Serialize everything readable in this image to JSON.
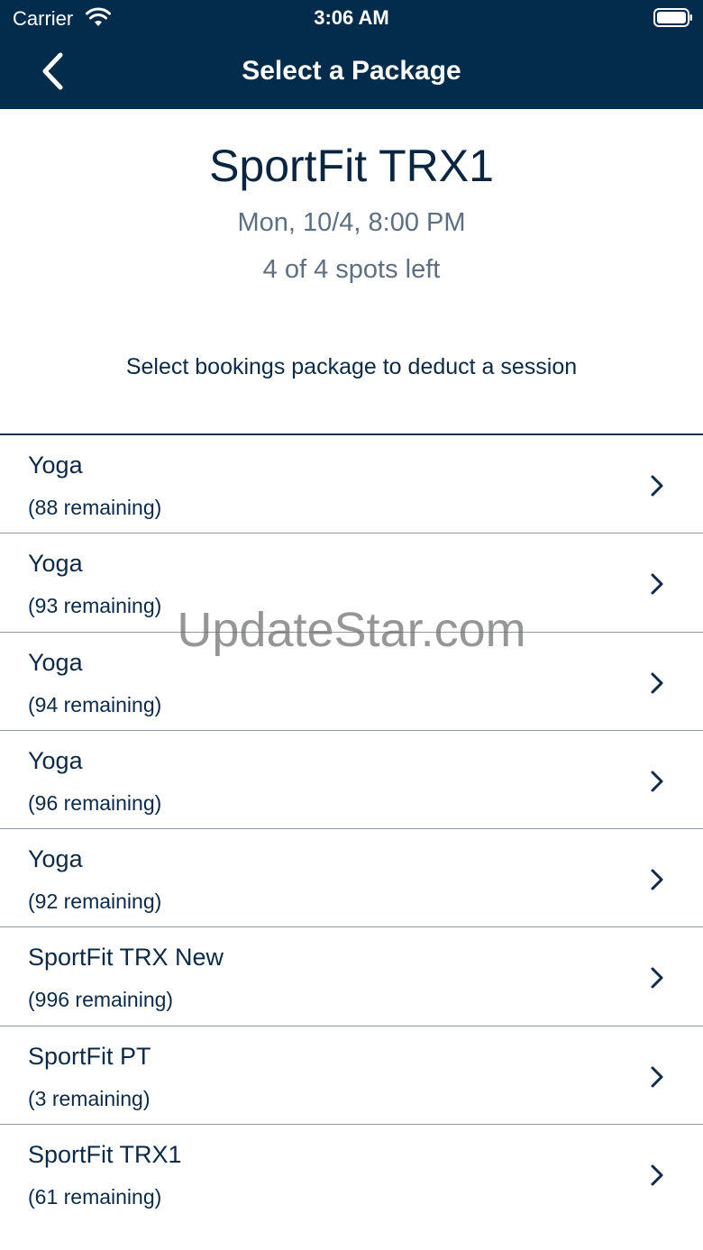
{
  "status_bar": {
    "carrier": "Carrier",
    "time": "3:06 AM"
  },
  "nav": {
    "title": "Select a Package"
  },
  "class_info": {
    "name": "SportFit TRX1",
    "datetime": "Mon, 10/4, 8:00 PM",
    "spots": "4 of 4 spots left"
  },
  "instruction": "Select bookings package to deduct a session",
  "packages": [
    {
      "name": "Yoga",
      "remaining": "(88 remaining)"
    },
    {
      "name": "Yoga",
      "remaining": "(93 remaining)"
    },
    {
      "name": "Yoga",
      "remaining": "(94 remaining)"
    },
    {
      "name": "Yoga",
      "remaining": "(96 remaining)"
    },
    {
      "name": "Yoga",
      "remaining": "(92 remaining)"
    },
    {
      "name": "SportFit TRX New",
      "remaining": "(996 remaining)"
    },
    {
      "name": "SportFit PT",
      "remaining": "(3 remaining)"
    },
    {
      "name": "SportFit TRX1",
      "remaining": "(61 remaining)"
    }
  ],
  "watermark": "UpdateStar.com",
  "colors": {
    "header": "#032b4c",
    "text": "#0c2a47",
    "subtext": "#5e6f82"
  }
}
